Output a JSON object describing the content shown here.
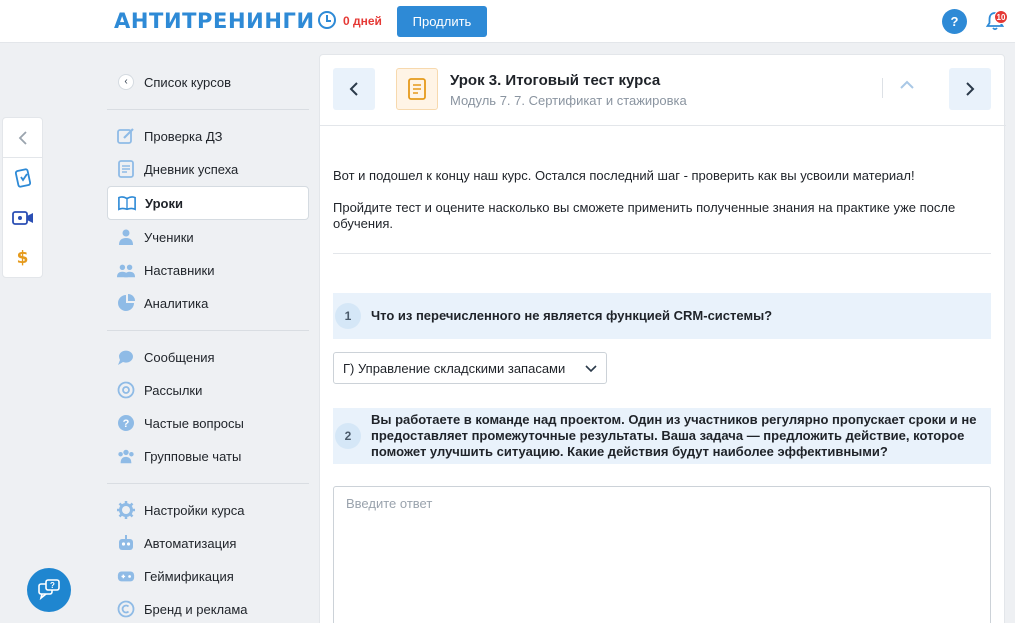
{
  "header": {
    "logo": "АНТИТРЕНИНГИ",
    "days_left": "0 дней",
    "extend_label": "Продлить",
    "help_label": "?",
    "notifications_count": "10"
  },
  "sidebar": {
    "back_label": "Список курсов",
    "groups": [
      [
        {
          "label": "Проверка ДЗ",
          "icon": "edit-icon"
        },
        {
          "label": "Дневник успеха",
          "icon": "diary-icon"
        },
        {
          "label": "Уроки",
          "icon": "book-icon",
          "active": true
        },
        {
          "label": "Ученики",
          "icon": "students-icon"
        },
        {
          "label": "Наставники",
          "icon": "mentors-icon"
        },
        {
          "label": "Аналитика",
          "icon": "pie-chart-icon"
        }
      ],
      [
        {
          "label": "Сообщения",
          "icon": "messages-icon"
        },
        {
          "label": "Рассылки",
          "icon": "at-icon"
        },
        {
          "label": "Частые вопросы",
          "icon": "question-icon"
        },
        {
          "label": "Групповые чаты",
          "icon": "group-chat-icon"
        }
      ],
      [
        {
          "label": "Настройки курса",
          "icon": "gear-icon"
        },
        {
          "label": "Автоматизация",
          "icon": "robot-icon"
        },
        {
          "label": "Геймификация",
          "icon": "gamepad-icon"
        },
        {
          "label": "Бренд и реклама",
          "icon": "copyright-icon"
        }
      ]
    ]
  },
  "lesson": {
    "title": "Урок 3. Итоговый тест курса",
    "module": "Модуль 7. 7. Сертификат и стажировка",
    "intro_1": "Вот и подошел к концу наш курс. Остался последний шаг - проверить как вы усвоили материал!",
    "intro_2": "Пройдите тест и оцените насколько вы сможете применить полученные знания на практике уже после обучения."
  },
  "questions": [
    {
      "number": "1",
      "text": "Что из перечисленного не является функцией CRM-системы?",
      "selected_answer": "Г) Управление складскими запасами"
    },
    {
      "number": "2",
      "text": "Вы работаете в команде над проектом. Один из участников регулярно пропускает сроки и не предоставляет промежуточные результаты. Ваша задача — предложить действие, которое поможет улучшить ситуацию. Какие действия будут наиболее эффективными?",
      "answer_placeholder": "Введите ответ"
    }
  ],
  "colors": {
    "accent": "#2e8ad6",
    "warning": "#e53935",
    "question_bg": "#e9f2fb",
    "lesson_icon": "#e59a1c"
  }
}
